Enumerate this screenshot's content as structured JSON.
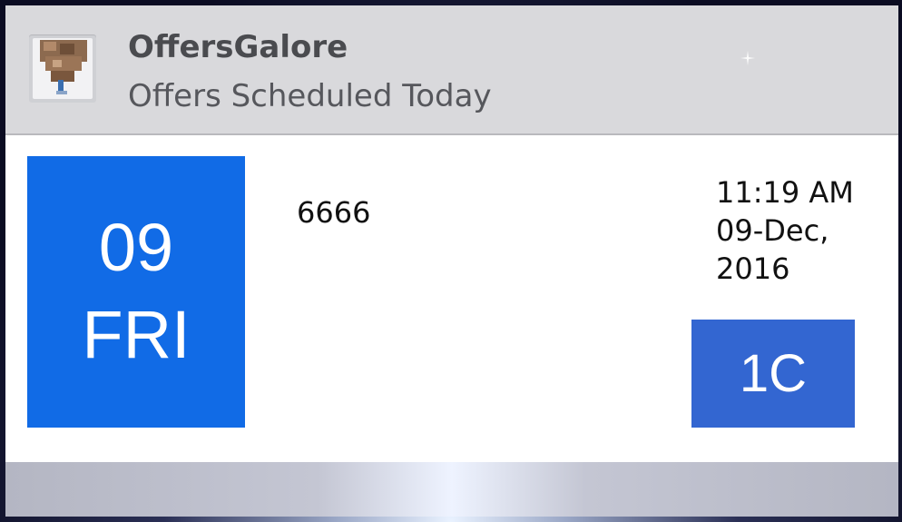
{
  "notification": {
    "app_name": "OffersGalore",
    "subtitle": "Offers Scheduled Today",
    "icon": "app-logo-icon"
  },
  "offer": {
    "date_day": "09",
    "date_weekday": "FRI",
    "code": "6666",
    "time": "11:19 AM",
    "date_line": "09-Dec,",
    "year_line": "2016",
    "badge": "1C"
  },
  "colors": {
    "header_bg": "#d9d9dc",
    "date_tile": "#116be6",
    "badge": "#3366d1"
  }
}
